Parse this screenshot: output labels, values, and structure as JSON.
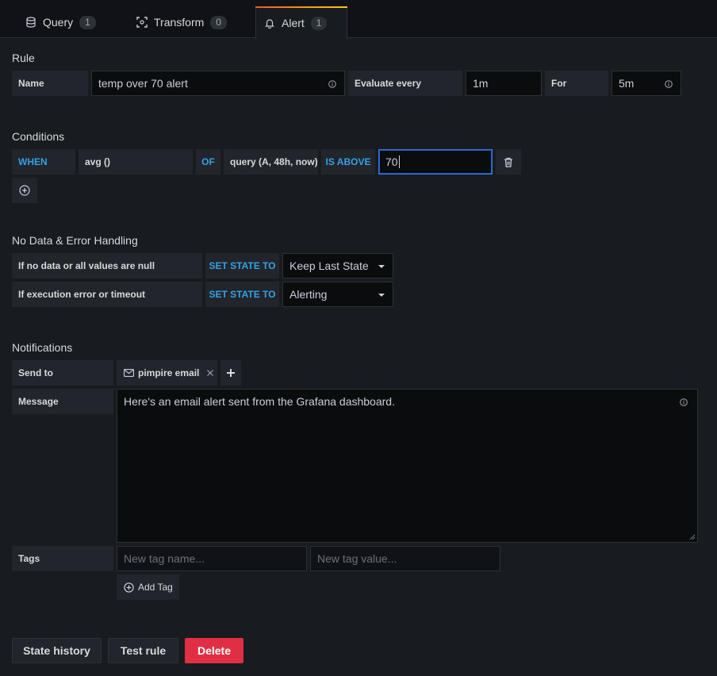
{
  "tabs": [
    {
      "label": "Query",
      "count": "1",
      "icon": "database-icon"
    },
    {
      "label": "Transform",
      "count": "0",
      "icon": "transform-icon"
    },
    {
      "label": "Alert",
      "count": "1",
      "icon": "bell-icon"
    }
  ],
  "rule": {
    "title": "Rule",
    "name_label": "Name",
    "name_value": "temp over 70 alert",
    "evaluate_label": "Evaluate every",
    "evaluate_value": "1m",
    "for_label": "For",
    "for_value": "5m"
  },
  "conditions": {
    "title": "Conditions",
    "when": "WHEN",
    "reducer": "avg ()",
    "of": "OF",
    "query": "query (A, 48h, now)",
    "evaluator": "IS ABOVE",
    "threshold": "70"
  },
  "no_data": {
    "title": "No Data & Error Handling",
    "rows": [
      {
        "label": "If no data or all values are null",
        "keyword": "SET STATE TO",
        "value": "Keep Last State"
      },
      {
        "label": "If execution error or timeout",
        "keyword": "SET STATE TO",
        "value": "Alerting"
      }
    ]
  },
  "notifications": {
    "title": "Notifications",
    "send_to_label": "Send to",
    "channel": "pimpire email",
    "message_label": "Message",
    "message": "Here's an email alert sent from the Grafana dashboard.",
    "tags_label": "Tags",
    "tag_name_placeholder": "New tag name...",
    "tag_value_placeholder": "New tag value...",
    "add_tag": "Add Tag"
  },
  "actions": {
    "state_history": "State history",
    "test_rule": "Test rule",
    "delete": "Delete"
  },
  "colors": {
    "accent_blue": "#33a2e5",
    "danger": "#e02f44",
    "tab_gradient_start": "#f05a28",
    "tab_gradient_end": "#fbca0a"
  }
}
